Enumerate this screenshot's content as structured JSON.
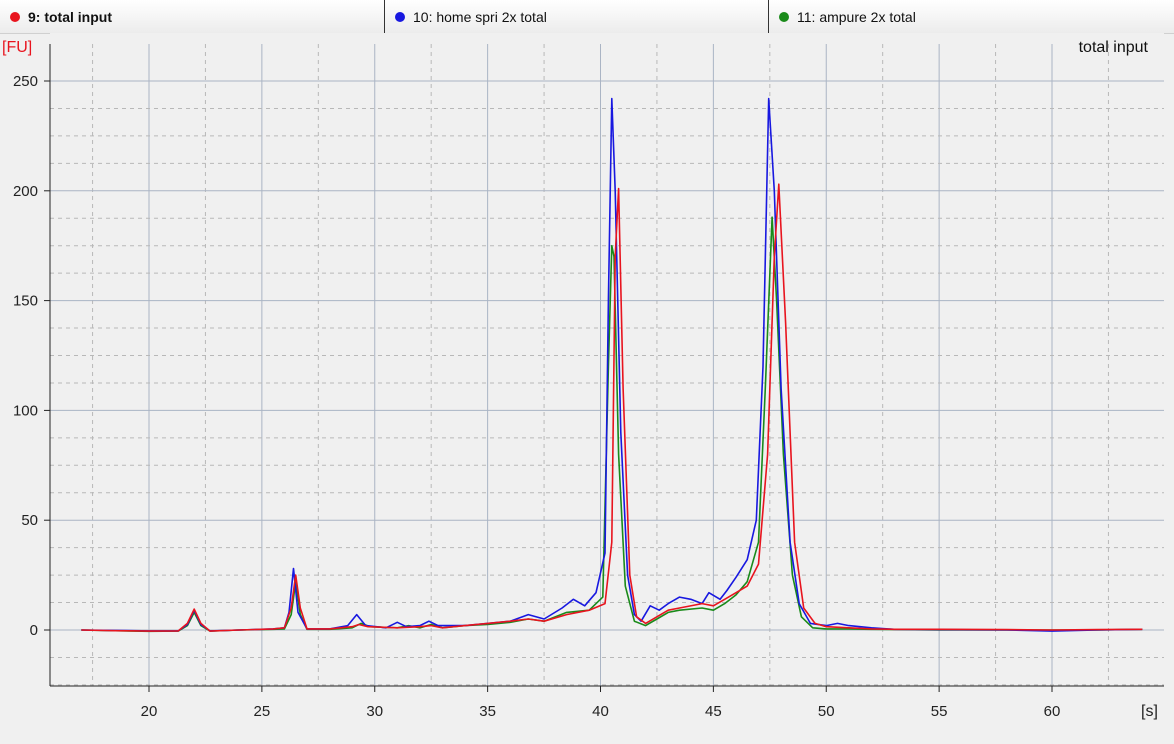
{
  "legend": [
    {
      "label": "9: total input",
      "color": "#e8141e"
    },
    {
      "label": "10: home spri 2x total",
      "color": "#1818e0"
    },
    {
      "label": "11: ampure 2x total",
      "color": "#1a8a1a"
    }
  ],
  "chart_data": {
    "type": "line",
    "title": "total input",
    "ylabel": "[FU]",
    "xlabel": "[s]",
    "xlim": [
      15.5,
      64.5
    ],
    "ylim": [
      -25,
      258
    ],
    "x_ticks": [
      20,
      25,
      30,
      35,
      40,
      45,
      50,
      55,
      60
    ],
    "y_ticks": [
      0,
      50,
      100,
      150,
      200,
      250
    ],
    "grid": true,
    "series": [
      {
        "name": "9: total input",
        "color": "#e8141e",
        "points": [
          [
            17,
            0
          ],
          [
            18.5,
            -0.3
          ],
          [
            20,
            -0.5
          ],
          [
            21.3,
            -0.4
          ],
          [
            21.7,
            3
          ],
          [
            22,
            9.5
          ],
          [
            22.3,
            3
          ],
          [
            22.7,
            -0.5
          ],
          [
            24,
            0
          ],
          [
            25.5,
            0.5
          ],
          [
            26,
            1
          ],
          [
            26.3,
            10
          ],
          [
            26.5,
            25
          ],
          [
            26.7,
            10
          ],
          [
            27,
            0.5
          ],
          [
            28,
            0.5
          ],
          [
            29,
            1.5
          ],
          [
            29.3,
            2.5
          ],
          [
            29.7,
            1.5
          ],
          [
            31,
            1
          ],
          [
            32,
            1.5
          ],
          [
            32.5,
            2
          ],
          [
            33,
            1
          ],
          [
            34,
            2
          ],
          [
            35,
            3
          ],
          [
            36,
            4
          ],
          [
            36.8,
            5
          ],
          [
            37.5,
            4
          ],
          [
            38.5,
            7
          ],
          [
            39.5,
            9
          ],
          [
            40.2,
            12
          ],
          [
            40.5,
            40
          ],
          [
            40.65,
            170
          ],
          [
            40.8,
            201
          ],
          [
            41,
            110
          ],
          [
            41.3,
            25
          ],
          [
            41.6,
            6
          ],
          [
            42,
            3
          ],
          [
            42.5,
            6
          ],
          [
            43,
            9
          ],
          [
            43.5,
            10
          ],
          [
            44.5,
            12
          ],
          [
            45,
            11
          ],
          [
            45.5,
            14
          ],
          [
            46,
            17
          ],
          [
            46.5,
            20
          ],
          [
            47,
            30
          ],
          [
            47.4,
            80
          ],
          [
            47.7,
            170
          ],
          [
            47.9,
            203
          ],
          [
            48.2,
            140
          ],
          [
            48.6,
            40
          ],
          [
            49,
            10
          ],
          [
            49.5,
            3
          ],
          [
            50,
            1.5
          ],
          [
            51,
            1
          ],
          [
            52,
            0.5
          ],
          [
            53,
            0.3
          ],
          [
            55,
            0.3
          ],
          [
            58,
            0.2
          ],
          [
            60,
            0
          ],
          [
            62,
            0.2
          ],
          [
            64,
            0.3
          ]
        ]
      },
      {
        "name": "10: home spri 2x total",
        "color": "#1818e0",
        "points": [
          [
            17,
            0
          ],
          [
            18.5,
            -0.2
          ],
          [
            20,
            -0.4
          ],
          [
            21.3,
            -0.4
          ],
          [
            21.7,
            2.5
          ],
          [
            22,
            9
          ],
          [
            22.3,
            2.5
          ],
          [
            22.7,
            -0.4
          ],
          [
            24,
            0
          ],
          [
            25.5,
            0.5
          ],
          [
            26,
            1
          ],
          [
            26.2,
            8
          ],
          [
            26.4,
            28
          ],
          [
            26.6,
            8
          ],
          [
            27,
            0.5
          ],
          [
            28,
            0.5
          ],
          [
            28.8,
            2
          ],
          [
            29.2,
            7
          ],
          [
            29.6,
            2
          ],
          [
            30.5,
            1
          ],
          [
            31,
            3.5
          ],
          [
            31.4,
            1.5
          ],
          [
            32,
            2
          ],
          [
            32.4,
            4
          ],
          [
            32.8,
            2
          ],
          [
            34,
            2
          ],
          [
            35,
            3
          ],
          [
            36,
            4
          ],
          [
            36.8,
            7
          ],
          [
            37.5,
            5
          ],
          [
            38.3,
            10
          ],
          [
            38.8,
            14
          ],
          [
            39.3,
            11
          ],
          [
            39.8,
            17
          ],
          [
            40.2,
            35
          ],
          [
            40.35,
            150
          ],
          [
            40.5,
            242
          ],
          [
            40.65,
            200
          ],
          [
            40.9,
            90
          ],
          [
            41.2,
            25
          ],
          [
            41.5,
            7
          ],
          [
            41.8,
            4
          ],
          [
            42.2,
            11
          ],
          [
            42.6,
            9
          ],
          [
            43,
            12
          ],
          [
            43.5,
            15
          ],
          [
            44,
            14
          ],
          [
            44.5,
            12
          ],
          [
            44.8,
            17
          ],
          [
            45.3,
            14
          ],
          [
            45.6,
            18
          ],
          [
            46,
            24
          ],
          [
            46.5,
            32
          ],
          [
            46.9,
            50
          ],
          [
            47.2,
            120
          ],
          [
            47.45,
            242
          ],
          [
            47.7,
            200
          ],
          [
            48,
            110
          ],
          [
            48.4,
            40
          ],
          [
            48.8,
            12
          ],
          [
            49.3,
            3
          ],
          [
            50,
            2
          ],
          [
            50.5,
            3
          ],
          [
            51,
            2
          ],
          [
            52,
            1
          ],
          [
            53,
            0.3
          ],
          [
            55,
            0.2
          ],
          [
            58,
            0
          ],
          [
            60,
            -0.5
          ],
          [
            62,
            0
          ],
          [
            64,
            0.3
          ]
        ]
      },
      {
        "name": "11: ampure 2x total",
        "color": "#1a8a1a",
        "points": [
          [
            17,
            0
          ],
          [
            18.5,
            -0.3
          ],
          [
            20,
            -0.6
          ],
          [
            21.3,
            -0.5
          ],
          [
            21.7,
            2
          ],
          [
            22,
            8
          ],
          [
            22.3,
            2
          ],
          [
            22.7,
            -0.5
          ],
          [
            24,
            0
          ],
          [
            25.5,
            0.3
          ],
          [
            26,
            0.5
          ],
          [
            26.3,
            7
          ],
          [
            26.5,
            22
          ],
          [
            26.7,
            7
          ],
          [
            27,
            0.3
          ],
          [
            28,
            0.3
          ],
          [
            29,
            1
          ],
          [
            29.4,
            3
          ],
          [
            29.8,
            1.5
          ],
          [
            31,
            1
          ],
          [
            31.5,
            2
          ],
          [
            32,
            1
          ],
          [
            32.5,
            2.5
          ],
          [
            33,
            1
          ],
          [
            34,
            2
          ],
          [
            35,
            2.5
          ],
          [
            36,
            3.5
          ],
          [
            36.8,
            5
          ],
          [
            37.5,
            4
          ],
          [
            38.5,
            8
          ],
          [
            39.5,
            9
          ],
          [
            40.1,
            15
          ],
          [
            40.35,
            120
          ],
          [
            40.5,
            175
          ],
          [
            40.6,
            170
          ],
          [
            40.8,
            80
          ],
          [
            41.1,
            20
          ],
          [
            41.5,
            4
          ],
          [
            42,
            2
          ],
          [
            42.5,
            5
          ],
          [
            43,
            8
          ],
          [
            43.5,
            9
          ],
          [
            44.5,
            10
          ],
          [
            45,
            9
          ],
          [
            45.5,
            12
          ],
          [
            46,
            16
          ],
          [
            46.5,
            22
          ],
          [
            47,
            40
          ],
          [
            47.3,
            110
          ],
          [
            47.6,
            188
          ],
          [
            47.8,
            150
          ],
          [
            48.1,
            80
          ],
          [
            48.5,
            25
          ],
          [
            48.9,
            6
          ],
          [
            49.4,
            1
          ],
          [
            50,
            0.5
          ],
          [
            51,
            0.5
          ],
          [
            52,
            0.3
          ],
          [
            55,
            0
          ],
          [
            58,
            0
          ],
          [
            60,
            0
          ],
          [
            62,
            0
          ],
          [
            64,
            0.3
          ]
        ]
      }
    ]
  }
}
